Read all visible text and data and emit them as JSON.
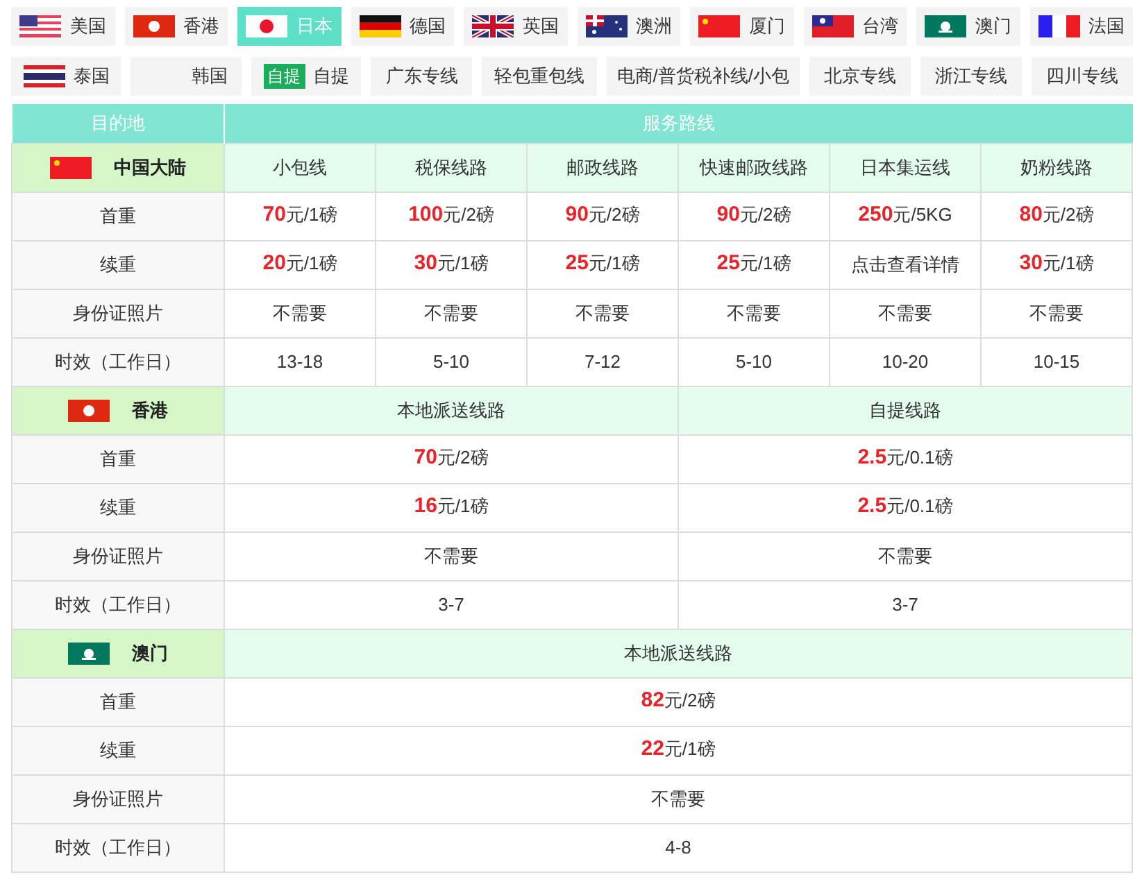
{
  "tab_rows": [
    [
      {
        "label": "美国",
        "kind": "us",
        "selected": false
      },
      {
        "label": "香港",
        "kind": "hk",
        "selected": false
      },
      {
        "label": "日本",
        "kind": "jp",
        "selected": true
      },
      {
        "label": "德国",
        "kind": "de",
        "selected": false
      },
      {
        "label": "英国",
        "kind": "gb",
        "selected": false
      },
      {
        "label": "澳洲",
        "kind": "au",
        "selected": false
      },
      {
        "label": "厦门",
        "kind": "cn",
        "selected": false
      },
      {
        "label": "台湾",
        "kind": "tw",
        "selected": false
      },
      {
        "label": "澳门",
        "kind": "mo",
        "selected": false
      },
      {
        "label": "法国",
        "kind": "fr",
        "selected": false
      }
    ],
    [
      {
        "label": "泰国",
        "kind": "th",
        "selected": false
      },
      {
        "label": "韩国",
        "kind": "blank",
        "selected": false
      },
      {
        "label": "自提",
        "badge": "自提",
        "selected": false
      },
      {
        "label": "广东专线",
        "selected": false
      },
      {
        "label": "轻包重包线",
        "selected": false
      },
      {
        "label": "电商/普货税补线/小包",
        "selected": false
      },
      {
        "label": "北京专线",
        "selected": false
      },
      {
        "label": "浙江专线",
        "selected": false
      },
      {
        "label": "四川专线",
        "selected": false
      }
    ]
  ],
  "table": {
    "header": [
      "目的地",
      "服务路线"
    ],
    "sections": [
      {
        "region": "中国大陆",
        "kind": "cn",
        "columns": [
          "小包线",
          "税保线路",
          "邮政线路",
          "快速邮政线路",
          "日本集运线",
          "奶粉线路"
        ],
        "rows": [
          {
            "label": "首重",
            "cells": [
              "**70**元/1磅",
              "**100**元/2磅",
              "**90**元/2磅",
              "**90**元/2磅",
              "**250**元/5KG",
              "**80**元/2磅"
            ]
          },
          {
            "label": "续重",
            "cells": [
              "**20**元/1磅",
              "**30**元/1磅",
              "**25**元/1磅",
              "**25**元/1磅",
              "点击查看详情",
              "**30**元/1磅"
            ]
          },
          {
            "label": "身份证照片",
            "cells": [
              "不需要",
              "不需要",
              "不需要",
              "不需要",
              "不需要",
              "不需要"
            ]
          },
          {
            "label": "时效（工作日）",
            "cells": [
              "13-18",
              "5-10",
              "7-12",
              "5-10",
              "10-20",
              "10-15"
            ]
          }
        ]
      },
      {
        "region": "香港",
        "kind": "hk",
        "columns": [
          "本地派送线路",
          "自提线路"
        ],
        "rows": [
          {
            "label": "首重",
            "cells": [
              "**70**元/2磅",
              "**2.5**元/0.1磅"
            ]
          },
          {
            "label": "续重",
            "cells": [
              "**16**元/1磅",
              "**2.5**元/0.1磅"
            ]
          },
          {
            "label": "身份证照片",
            "cells": [
              "不需要",
              "不需要"
            ]
          },
          {
            "label": "时效（工作日）",
            "cells": [
              "3-7",
              "3-7"
            ]
          }
        ]
      },
      {
        "region": "澳门",
        "kind": "mo",
        "columns": [
          "本地派送线路"
        ],
        "rows": [
          {
            "label": "首重",
            "cells": [
              "**82**元/2磅"
            ]
          },
          {
            "label": "续重",
            "cells": [
              "**22**元/1磅"
            ]
          },
          {
            "label": "身份证照片",
            "cells": [
              "不需要"
            ]
          },
          {
            "label": "时效（工作日）",
            "cells": [
              "4-8"
            ]
          }
        ]
      }
    ]
  }
}
